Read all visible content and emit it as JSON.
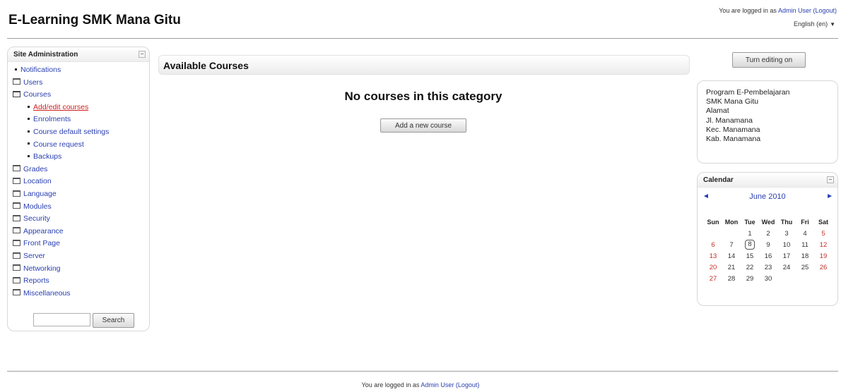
{
  "header": {
    "site_title": "E-Learning SMK Mana Gitu",
    "login_prefix": "You are logged in as",
    "user_name": "Admin User",
    "logout": "(Logout)",
    "language": "English (en)"
  },
  "admin_block": {
    "title": "Site Administration",
    "items": [
      {
        "label": "Notifications",
        "icon": "bullet"
      },
      {
        "label": "Users",
        "icon": "folder"
      },
      {
        "label": "Courses",
        "icon": "folder-open"
      },
      {
        "label": "Add/edit courses",
        "icon": "bullet",
        "sub": true,
        "active": true
      },
      {
        "label": "Enrolments",
        "icon": "bullet",
        "sub": true
      },
      {
        "label": "Course default settings",
        "icon": "bullet",
        "sub": true
      },
      {
        "label": "Course request",
        "icon": "bullet",
        "sub": true
      },
      {
        "label": "Backups",
        "icon": "bullet",
        "sub": true
      },
      {
        "label": "Grades",
        "icon": "folder"
      },
      {
        "label": "Location",
        "icon": "folder"
      },
      {
        "label": "Language",
        "icon": "folder"
      },
      {
        "label": "Modules",
        "icon": "folder"
      },
      {
        "label": "Security",
        "icon": "folder"
      },
      {
        "label": "Appearance",
        "icon": "folder"
      },
      {
        "label": "Front Page",
        "icon": "folder"
      },
      {
        "label": "Server",
        "icon": "folder"
      },
      {
        "label": "Networking",
        "icon": "folder"
      },
      {
        "label": "Reports",
        "icon": "folder"
      },
      {
        "label": "Miscellaneous",
        "icon": "folder"
      }
    ],
    "search_button": "Search",
    "search_value": ""
  },
  "main": {
    "heading": "Available Courses",
    "empty_message": "No courses in this category",
    "add_button": "Add a new course"
  },
  "right": {
    "editing_button": "Turn editing on",
    "info_lines": [
      "Program E-Pembelajaran",
      "SMK Mana Gitu",
      "Alamat",
      "Jl. Manamana",
      "Kec. Manamana",
      "Kab. Manamana"
    ],
    "calendar": {
      "title": "Calendar",
      "month": "June 2010",
      "days": [
        "Sun",
        "Mon",
        "Tue",
        "Wed",
        "Thu",
        "Fri",
        "Sat"
      ],
      "weeks": [
        [
          "",
          "",
          "1",
          "2",
          "3",
          "4",
          "5"
        ],
        [
          "6",
          "7",
          "8",
          "9",
          "10",
          "11",
          "12"
        ],
        [
          "13",
          "14",
          "15",
          "16",
          "17",
          "18",
          "19"
        ],
        [
          "20",
          "21",
          "22",
          "23",
          "24",
          "25",
          "26"
        ],
        [
          "27",
          "28",
          "29",
          "30",
          "",
          "",
          ""
        ]
      ],
      "today": "8"
    }
  },
  "footer": {
    "login_prefix": "You are logged in as",
    "user_name": "Admin User",
    "logout": "(Logout)"
  }
}
